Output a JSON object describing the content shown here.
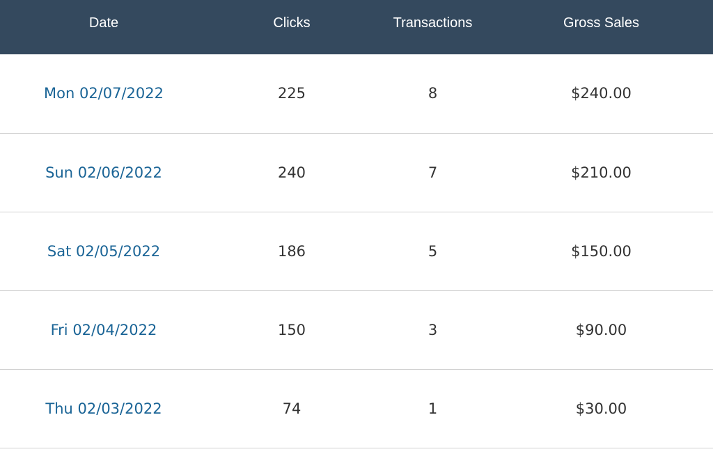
{
  "table": {
    "headers": {
      "date": "Date",
      "clicks": "Clicks",
      "transactions": "Transactions",
      "gross_sales": "Gross Sales"
    },
    "rows": [
      {
        "date": "Mon 02/07/2022",
        "clicks": "225",
        "transactions": "8",
        "gross_sales": "$240.00"
      },
      {
        "date": "Sun 02/06/2022",
        "clicks": "240",
        "transactions": "7",
        "gross_sales": "$210.00"
      },
      {
        "date": "Sat 02/05/2022",
        "clicks": "186",
        "transactions": "5",
        "gross_sales": "$150.00"
      },
      {
        "date": "Fri 02/04/2022",
        "clicks": "150",
        "transactions": "3",
        "gross_sales": "$90.00"
      },
      {
        "date": "Thu 02/03/2022",
        "clicks": "74",
        "transactions": "1",
        "gross_sales": "$30.00"
      }
    ]
  },
  "colors": {
    "header_background": "#34495e",
    "header_text": "#ffffff",
    "link": "#1a6496",
    "cell_text": "#333333",
    "row_divider": "#d0d0d0"
  }
}
